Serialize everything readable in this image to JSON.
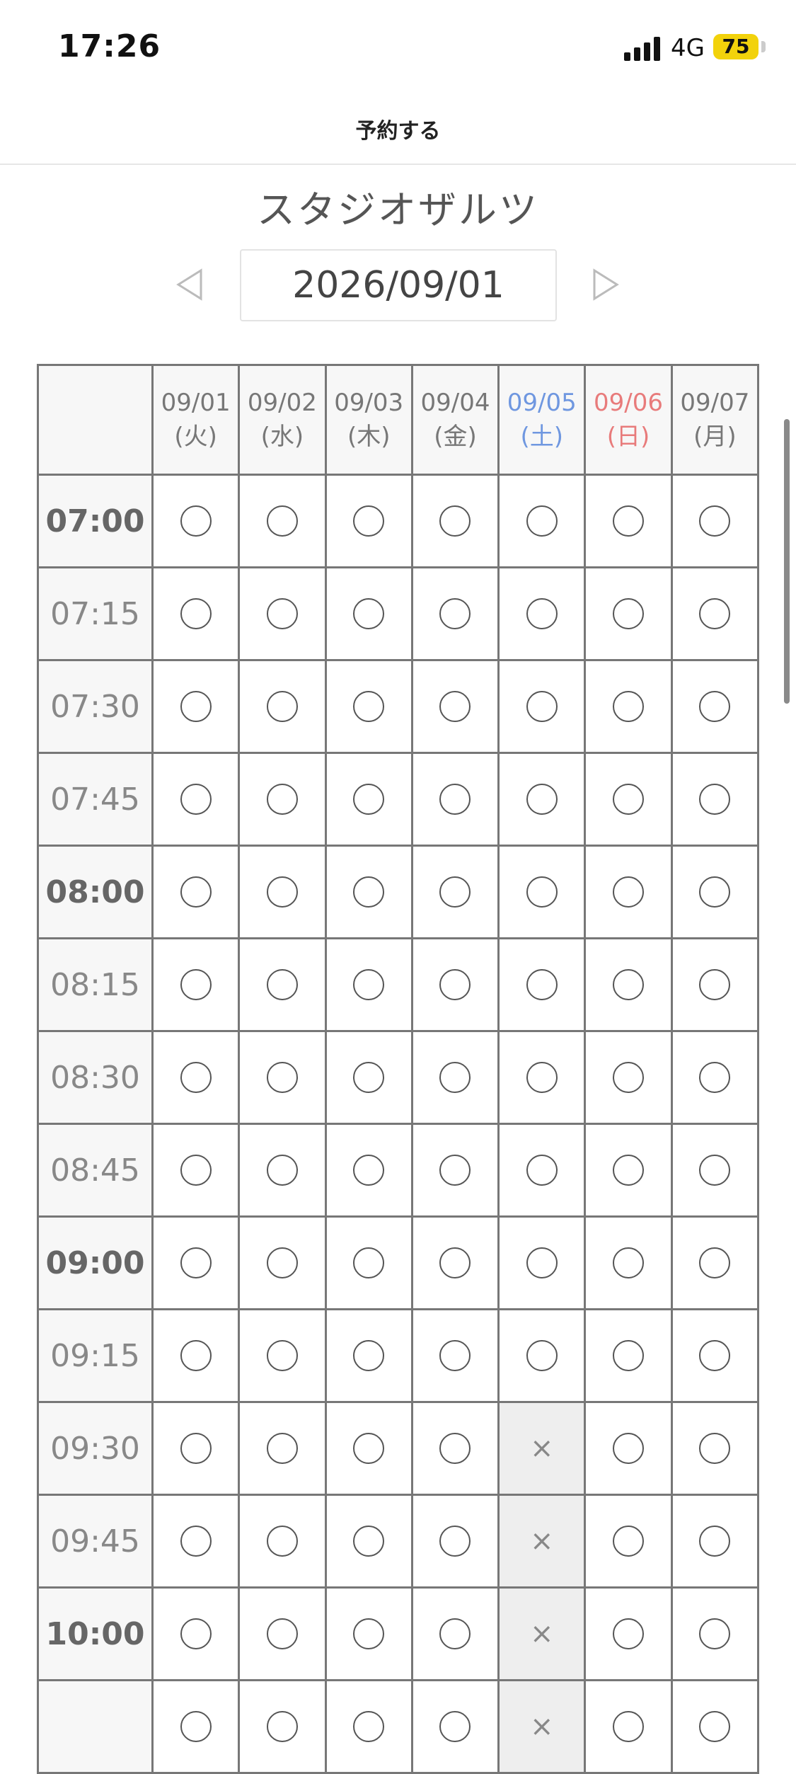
{
  "status_bar": {
    "time": "17:26",
    "network": "4G",
    "battery": "75"
  },
  "nav": {
    "title": "予約する"
  },
  "studio_name": "スタジオザルツ",
  "date_picker": {
    "current_date": "2026/09/01",
    "prev_icon": "triangle-left-icon",
    "next_icon": "triangle-right-icon"
  },
  "colors": {
    "saturday": "#6f97e0",
    "sunday": "#e87b7b",
    "battery": "#f2d20b",
    "unavailable_bg": "#eeeeee"
  },
  "schedule": {
    "days": [
      {
        "date": "09/01",
        "weekday": "(火)",
        "type": "weekday"
      },
      {
        "date": "09/02",
        "weekday": "(水)",
        "type": "weekday"
      },
      {
        "date": "09/03",
        "weekday": "(木)",
        "type": "weekday"
      },
      {
        "date": "09/04",
        "weekday": "(金)",
        "type": "weekday"
      },
      {
        "date": "09/05",
        "weekday": "(土)",
        "type": "saturday"
      },
      {
        "date": "09/06",
        "weekday": "(日)",
        "type": "sunday"
      },
      {
        "date": "09/07",
        "weekday": "(月)",
        "type": "weekday"
      }
    ],
    "available_symbol": "○",
    "unavailable_symbol": "×",
    "rows": [
      {
        "time": "07:00",
        "hour": true,
        "slots": [
          1,
          1,
          1,
          1,
          1,
          1,
          1
        ]
      },
      {
        "time": "07:15",
        "hour": false,
        "slots": [
          1,
          1,
          1,
          1,
          1,
          1,
          1
        ]
      },
      {
        "time": "07:30",
        "hour": false,
        "slots": [
          1,
          1,
          1,
          1,
          1,
          1,
          1
        ]
      },
      {
        "time": "07:45",
        "hour": false,
        "slots": [
          1,
          1,
          1,
          1,
          1,
          1,
          1
        ]
      },
      {
        "time": "08:00",
        "hour": true,
        "slots": [
          1,
          1,
          1,
          1,
          1,
          1,
          1
        ]
      },
      {
        "time": "08:15",
        "hour": false,
        "slots": [
          1,
          1,
          1,
          1,
          1,
          1,
          1
        ]
      },
      {
        "time": "08:30",
        "hour": false,
        "slots": [
          1,
          1,
          1,
          1,
          1,
          1,
          1
        ]
      },
      {
        "time": "08:45",
        "hour": false,
        "slots": [
          1,
          1,
          1,
          1,
          1,
          1,
          1
        ]
      },
      {
        "time": "09:00",
        "hour": true,
        "slots": [
          1,
          1,
          1,
          1,
          1,
          1,
          1
        ]
      },
      {
        "time": "09:15",
        "hour": false,
        "slots": [
          1,
          1,
          1,
          1,
          1,
          1,
          1
        ]
      },
      {
        "time": "09:30",
        "hour": false,
        "slots": [
          1,
          1,
          1,
          1,
          0,
          1,
          1
        ]
      },
      {
        "time": "09:45",
        "hour": false,
        "slots": [
          1,
          1,
          1,
          1,
          0,
          1,
          1
        ]
      },
      {
        "time": "10:00",
        "hour": true,
        "slots": [
          1,
          1,
          1,
          1,
          0,
          1,
          1
        ]
      },
      {
        "time": "",
        "hour": false,
        "slots": [
          1,
          1,
          1,
          1,
          0,
          1,
          1
        ]
      }
    ]
  }
}
